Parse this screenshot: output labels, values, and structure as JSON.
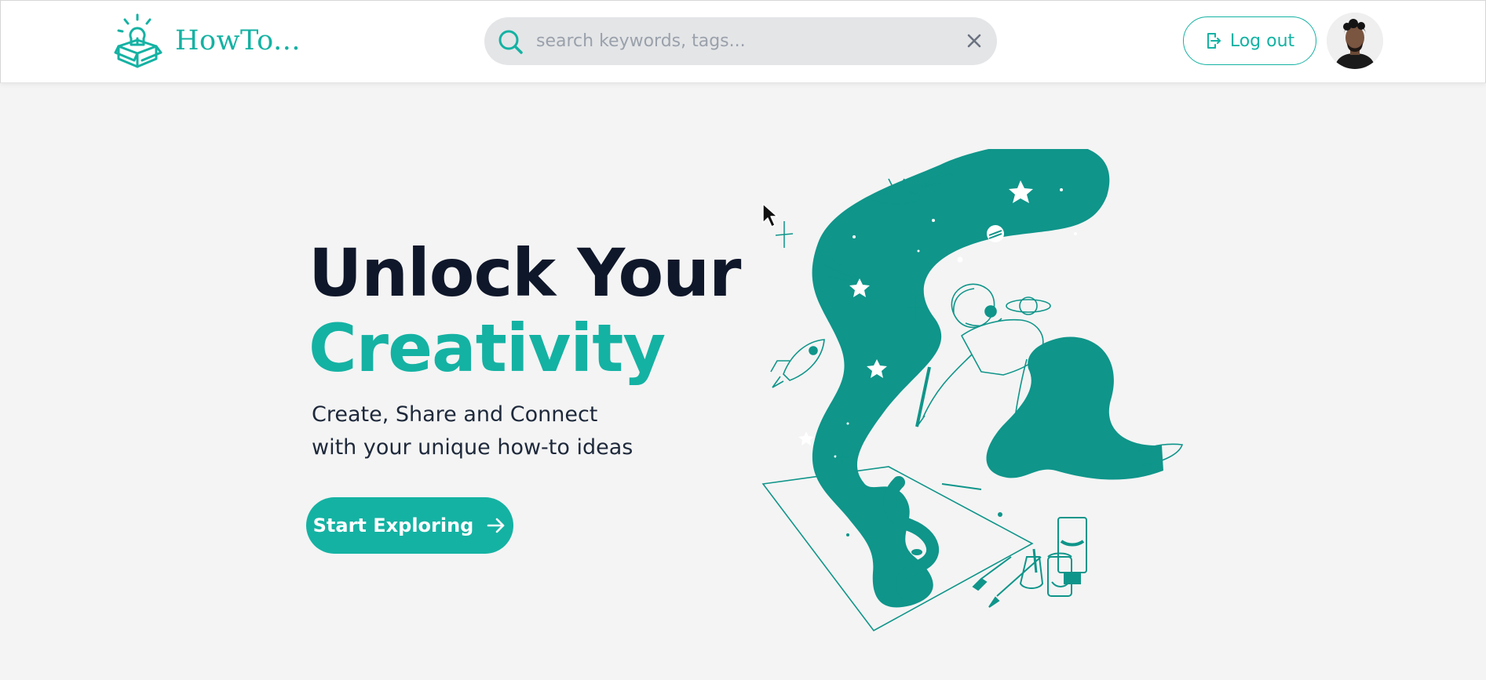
{
  "header": {
    "brand": "HowTo...",
    "logo_icon": "lightbulb-box-icon",
    "search": {
      "placeholder": "search keywords, tags...",
      "value": "",
      "icon": "search-icon",
      "clear_icon": "close-icon"
    },
    "logout_label": "Log out",
    "logout_icon": "logout-icon",
    "avatar_icon": "user-avatar"
  },
  "hero": {
    "title_line1": "Unlock Your",
    "title_line2": "Creativity",
    "subtitle_line1": "Create, Share and Connect",
    "subtitle_line2": "with your unique how-to ideas",
    "cta_label": "Start Exploring",
    "cta_icon": "arrow-right-icon",
    "illustration": "space-painting-illustration"
  },
  "colors": {
    "accent": "#14b2a3",
    "illustration_teal": "#0f958a",
    "title_dark": "#0f172a",
    "background": "#f4f4f4",
    "search_bg": "#e4e5e7"
  }
}
